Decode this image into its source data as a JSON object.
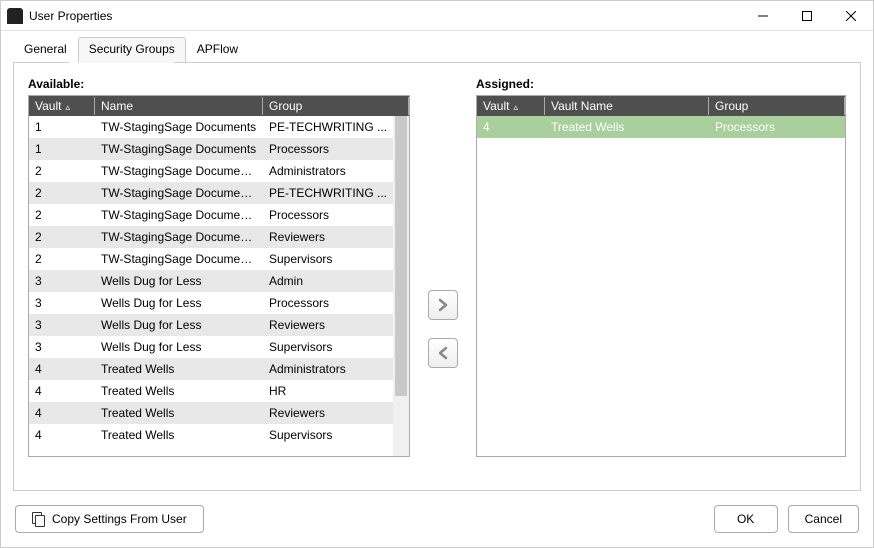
{
  "window": {
    "title": "User Properties"
  },
  "tabs": {
    "general": "General",
    "security_groups": "Security Groups",
    "apflow": "APFlow",
    "active_index": 1
  },
  "labels": {
    "available": "Available:",
    "assigned": "Assigned:"
  },
  "available": {
    "headers": {
      "vault": "Vault",
      "name": "Name",
      "group": "Group"
    },
    "rows": [
      {
        "vault": "1",
        "name": "TW-StagingSage Documents",
        "group": "PE-TECHWRITING ..."
      },
      {
        "vault": "1",
        "name": "TW-StagingSage Documents",
        "group": "Processors"
      },
      {
        "vault": "2",
        "name": "TW-StagingSage Documents Test",
        "group": "Administrators"
      },
      {
        "vault": "2",
        "name": "TW-StagingSage Documents Test",
        "group": "PE-TECHWRITING ..."
      },
      {
        "vault": "2",
        "name": "TW-StagingSage Documents Test",
        "group": "Processors"
      },
      {
        "vault": "2",
        "name": "TW-StagingSage Documents Test",
        "group": "Reviewers"
      },
      {
        "vault": "2",
        "name": "TW-StagingSage Documents Test",
        "group": "Supervisors"
      },
      {
        "vault": "3",
        "name": "Wells Dug for Less",
        "group": "Admin"
      },
      {
        "vault": "3",
        "name": "Wells Dug for Less",
        "group": "Processors"
      },
      {
        "vault": "3",
        "name": "Wells Dug for Less",
        "group": "Reviewers"
      },
      {
        "vault": "3",
        "name": "Wells Dug for Less",
        "group": "Supervisors"
      },
      {
        "vault": "4",
        "name": "Treated Wells",
        "group": "Administrators"
      },
      {
        "vault": "4",
        "name": "Treated Wells",
        "group": "HR"
      },
      {
        "vault": "4",
        "name": "Treated Wells",
        "group": "Reviewers"
      },
      {
        "vault": "4",
        "name": "Treated Wells",
        "group": "Supervisors"
      }
    ]
  },
  "assigned": {
    "headers": {
      "vault": "Vault",
      "vault_name": "Vault Name",
      "group": "Group"
    },
    "rows": [
      {
        "vault": "4",
        "vault_name": "Treated Wells",
        "group": "Processors",
        "selected": true
      }
    ]
  },
  "buttons": {
    "copy_settings": "Copy Settings From User",
    "ok": "OK",
    "cancel": "Cancel"
  }
}
